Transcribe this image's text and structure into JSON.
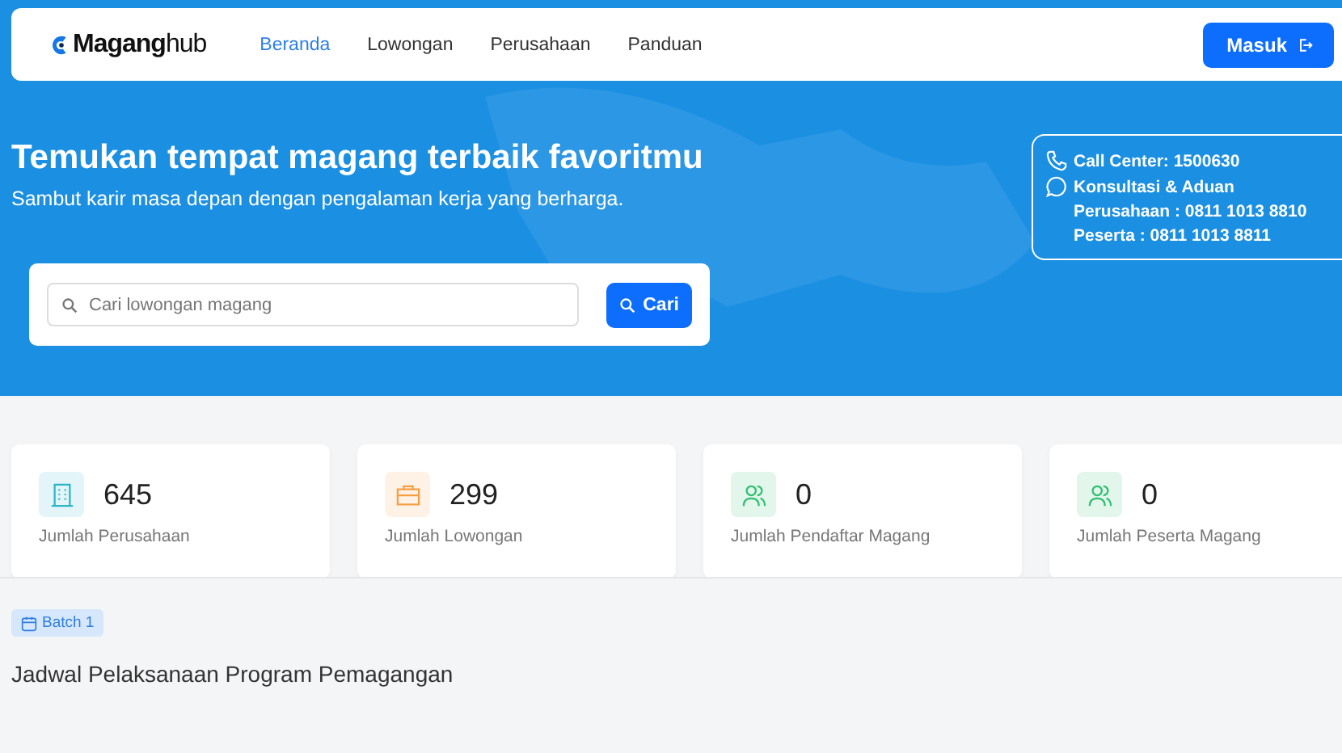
{
  "nav": {
    "logo": "**Magang**hub",
    "links": [
      {
        "label": "Beranda",
        "selected": true
      },
      {
        "label": "Lowongan",
        "selected": false
      },
      {
        "label": "Perusahaan",
        "selected": false
      },
      {
        "label": "Panduan",
        "selected": false
      }
    ],
    "login": "Masuk"
  },
  "hero": {
    "title": "Temukan tempat magang terbaik favoritmu",
    "subtitle": "Sambut karir masa depan dengan pengalaman kerja yang berharga.",
    "search": {
      "placeholder": "Cari lowongan magang",
      "button": "Cari"
    },
    "contact": [
      {
        "kind": "phone",
        "text": "Call Center: 1500630"
      },
      {
        "kind": "chat",
        "text": "Konsultasi & Aduan"
      },
      {
        "kind": "none",
        "text": "Perusahaan : 0811 1013 8810"
      },
      {
        "kind": "none",
        "text": "Peserta : 0811 1013 8811"
      }
    ]
  },
  "stats": [
    {
      "kind": "building",
      "color": "#2bb5c9",
      "value": "645",
      "label": "Jumlah Perusahaan"
    },
    {
      "kind": "briefcase",
      "color": "#f59e42",
      "value": "299",
      "label": "Jumlah Lowongan"
    },
    {
      "kind": "users",
      "color": "#2fbf71",
      "value": "0",
      "label": "Jumlah Pendaftar Magang"
    },
    {
      "kind": "users",
      "color": "#2fbf71",
      "value": "0",
      "label": "Jumlah Peserta Magang"
    }
  ],
  "schedule": {
    "badge": "Batch 1",
    "title": "Jadwal Pelaksanaan Program Pemagangan"
  }
}
